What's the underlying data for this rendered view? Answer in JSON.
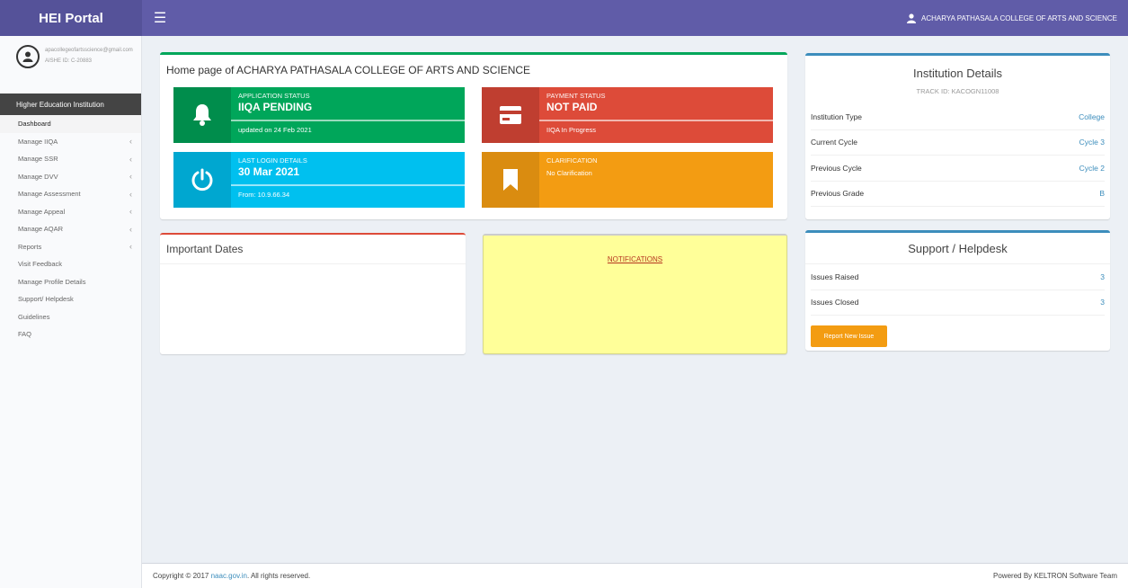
{
  "header": {
    "brand": "HEI Portal",
    "toggle_icon": "☰",
    "user_name": "ACHARYA PATHASALA COLLEGE OF ARTS AND SCIENCE",
    "color": "#605ca8"
  },
  "sidebar": {
    "user_email": "apacollegeofartsscience@gmail.com",
    "aishe": "AISHE ID: C-20883",
    "section_header": "Higher Education Institution",
    "items": [
      {
        "label": "Dashboard",
        "chevron": ""
      },
      {
        "label": "Manage IIQA",
        "chevron": "‹"
      },
      {
        "label": "Manage SSR",
        "chevron": "‹"
      },
      {
        "label": "Manage DVV",
        "chevron": "‹"
      },
      {
        "label": "Manage Assessment",
        "chevron": "‹"
      },
      {
        "label": "Manage Appeal",
        "chevron": "‹"
      },
      {
        "label": "Manage AQAR",
        "chevron": "‹"
      },
      {
        "label": "Reports",
        "chevron": "‹"
      },
      {
        "label": "Visit Feedback",
        "chevron": ""
      },
      {
        "label": "Manage Profile Details",
        "chevron": ""
      },
      {
        "label": "Support/ Helpdesk",
        "chevron": ""
      },
      {
        "label": "Guidelines",
        "chevron": ""
      },
      {
        "label": "FAQ",
        "chevron": ""
      }
    ]
  },
  "home": {
    "title": "Home page of ACHARYA PATHASALA COLLEGE OF ARTS AND SCIENCE",
    "cards": {
      "application": {
        "label": "APPLICATION STATUS",
        "value": "IIQA PENDING",
        "desc": "updated on 24 Feb 2021",
        "icon": "bell-icon",
        "color": "#00a65a"
      },
      "payment": {
        "label": "PAYMENT STATUS",
        "value": "NOT PAID",
        "desc": "IIQA In Progress",
        "icon": "credit-card-icon",
        "color": "#dd4b39"
      },
      "login": {
        "label": "LAST LOGIN DETAILS",
        "value": "30 Mar 2021",
        "desc": "From: 10.9.66.34",
        "icon": "power-icon",
        "color": "#00c0ef"
      },
      "clarification": {
        "label": "CLARIFICATION",
        "value": "",
        "desc": "No Clarification",
        "icon": "bookmark-icon",
        "color": "#f39c12"
      }
    }
  },
  "important_dates": {
    "title": "Important Dates"
  },
  "notifications": {
    "link": "NOTIFICATIONS"
  },
  "institution": {
    "title": "Institution Details",
    "track_id": "TRACK ID: KACOGN11008",
    "rows": [
      {
        "label": "Institution Type",
        "value": "College"
      },
      {
        "label": "Current Cycle",
        "value": "Cycle 3"
      },
      {
        "label": "Previous Cycle",
        "value": "Cycle 2"
      },
      {
        "label": "Previous Grade",
        "value": "B"
      }
    ]
  },
  "support": {
    "title": "Support / Helpdesk",
    "rows": [
      {
        "label": "Issues Raised",
        "value": "3"
      },
      {
        "label": "Issues Closed",
        "value": "3"
      }
    ],
    "button": "Report New Issue"
  },
  "footer": {
    "copyright_prefix": "Copyright © 2017",
    "link": "naac.gov.in",
    "rights": ". All rights reserved.",
    "powered": "Powered By KELTRON Software Team"
  }
}
